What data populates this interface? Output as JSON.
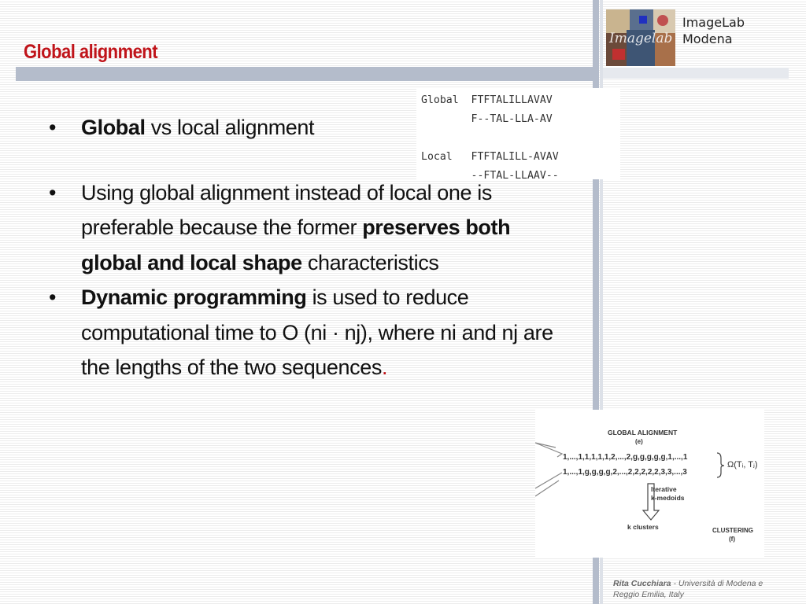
{
  "slide": {
    "title": "Global alignment"
  },
  "logo": {
    "line1": "ImageLab",
    "line2": "Modena"
  },
  "alignment_table": {
    "rows": [
      {
        "label": "Global",
        "seq": "FTFTALILLAVAV"
      },
      {
        "label": "",
        "seq": "F--TAL-LLA-AV"
      },
      {
        "label": "",
        "seq": ""
      },
      {
        "label": "Local",
        "seq": "FTFTALILL-AVAV"
      },
      {
        "label": "",
        "seq": "--FTAL-LLAAV--"
      }
    ]
  },
  "bullets": [
    {
      "bold": "Global",
      "text": " vs local alignment"
    },
    {
      "text_before": "Using global alignment instead of local one is preferable because the former ",
      "bold": "preserves both global and local shape",
      "text_after": " characteristics"
    },
    {
      "bold": "Dynamic programming",
      "text": " is used to reduce computational time to O (ni · nj), where ni and nj are the lengths of the two sequences",
      "end": "."
    }
  ],
  "figure": {
    "title_line1": "GLOBAL ALIGNMENT",
    "title_line2": "(e)",
    "seq1": "1,...,1,1,1,1,1,2,...,2,g,g,g,g,g,1,...,1",
    "seq2": "1,...,1,g,g,g,g,2,...,2,2,2,2,2,3,3,...,3",
    "omega": "Ω(Tᵢ, Tⱼ)",
    "step_line1": "Iterative",
    "step_line2": "k-medoids",
    "result": "k clusters",
    "clustering_line1": "CLUSTERING",
    "clustering_line2": "(f)"
  },
  "footer": {
    "author": "Rita Cucchiara",
    "affiliation": " - Università di Modena e Reggio Emilia, Italy"
  },
  "colors": {
    "title_red": "#c0141a",
    "bar_gray": "#b4bccb"
  }
}
